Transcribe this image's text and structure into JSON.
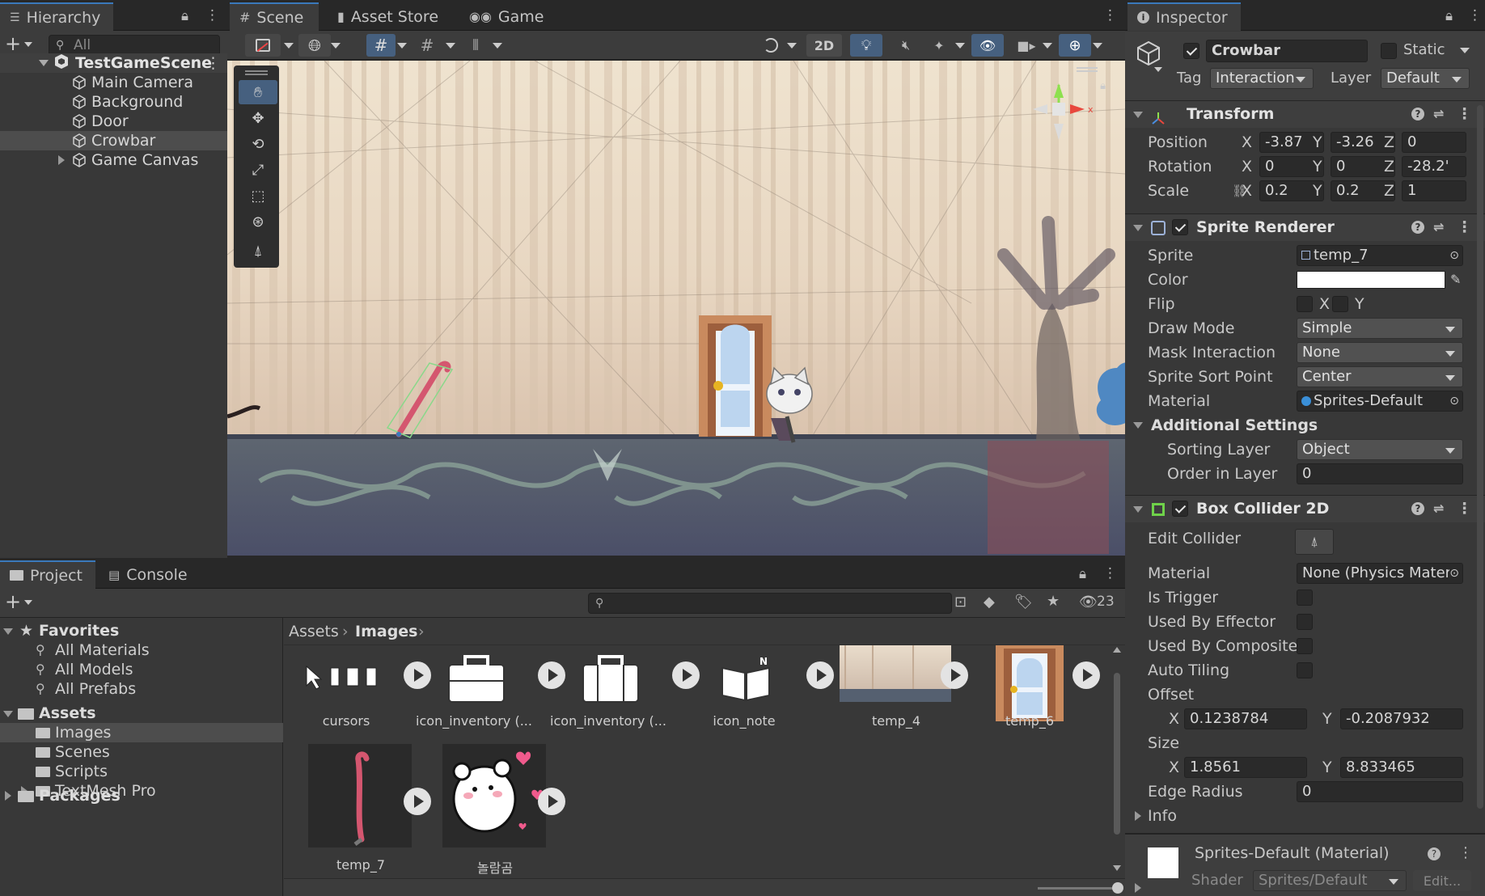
{
  "hierarchy": {
    "tab": "Hierarchy",
    "search_placeholder": "All",
    "scene": "TestGameScene",
    "items": [
      "Main Camera",
      "Background",
      "Door",
      "Crowbar",
      "Game Canvas"
    ]
  },
  "scene_view": {
    "tabs": [
      "Scene",
      "Asset Store",
      "Game"
    ],
    "btn_2d": "2D"
  },
  "inspector": {
    "tab": "Inspector",
    "object_name": "Crowbar",
    "static_label": "Static",
    "tag_label": "Tag",
    "tag_value": "Interaction",
    "layer_label": "Layer",
    "layer_value": "Default",
    "transform": {
      "title": "Transform",
      "position_label": "Position",
      "rotation_label": "Rotation",
      "scale_label": "Scale",
      "position": [
        "-3.87",
        "-3.26",
        "0"
      ],
      "rotation": [
        "0",
        "0",
        "-28.2'"
      ],
      "scale": [
        "0.2",
        "0.2",
        "1"
      ]
    },
    "axes": [
      "X",
      "Y",
      "Z"
    ],
    "sprite_renderer": {
      "title": "Sprite Renderer",
      "sprite_label": "Sprite",
      "sprite_value": "temp_7",
      "color_label": "Color",
      "color_value": "#ffffff",
      "flip_label": "Flip",
      "flip_x": "X",
      "flip_y": "Y",
      "draw_mode_label": "Draw Mode",
      "draw_mode": "Simple",
      "mask_label": "Mask Interaction",
      "mask": "None",
      "sort_point_label": "Sprite Sort Point",
      "sort_point": "Center",
      "material_label": "Material",
      "material": "Sprites-Default",
      "additional": "Additional Settings",
      "sorting_layer_label": "Sorting Layer",
      "sorting_layer": "Object",
      "order_label": "Order in Layer",
      "order": "0"
    },
    "box_collider": {
      "title": "Box Collider 2D",
      "edit_label": "Edit Collider",
      "material_label": "Material",
      "material": "None (Physics Mater",
      "trigger_label": "Is Trigger",
      "effector_label": "Used By Effector",
      "composite_label": "Used By Composite",
      "tiling_label": "Auto Tiling",
      "offset_label": "Offset",
      "offset_x": "0.1238784",
      "offset_y": "-0.2087932",
      "size_label": "Size",
      "size_x": "1.8561",
      "size_y": "8.833465",
      "edge_label": "Edge Radius",
      "edge": "0",
      "info_label": "Info"
    },
    "material_footer": {
      "title": "Sprites-Default (Material)",
      "shader_label": "Shader",
      "shader": "Sprites/Default",
      "edit": "Edit..."
    }
  },
  "project": {
    "tabs": [
      "Project",
      "Console"
    ],
    "favorites_label": "Favorites",
    "favorites": [
      "All Materials",
      "All Models",
      "All Prefabs"
    ],
    "assets_label": "Assets",
    "folders": [
      "Images",
      "Scenes",
      "Scripts",
      "TextMesh Pro"
    ],
    "packages_label": "Packages",
    "breadcrumb": [
      "Assets",
      "Images"
    ],
    "hidden_count": "23",
    "assets": [
      "cursors",
      "icon_inventory (...",
      "icon_inventory (...",
      "icon_note",
      "temp_4",
      "temp_6",
      "temp_7",
      "놀람곰"
    ]
  }
}
